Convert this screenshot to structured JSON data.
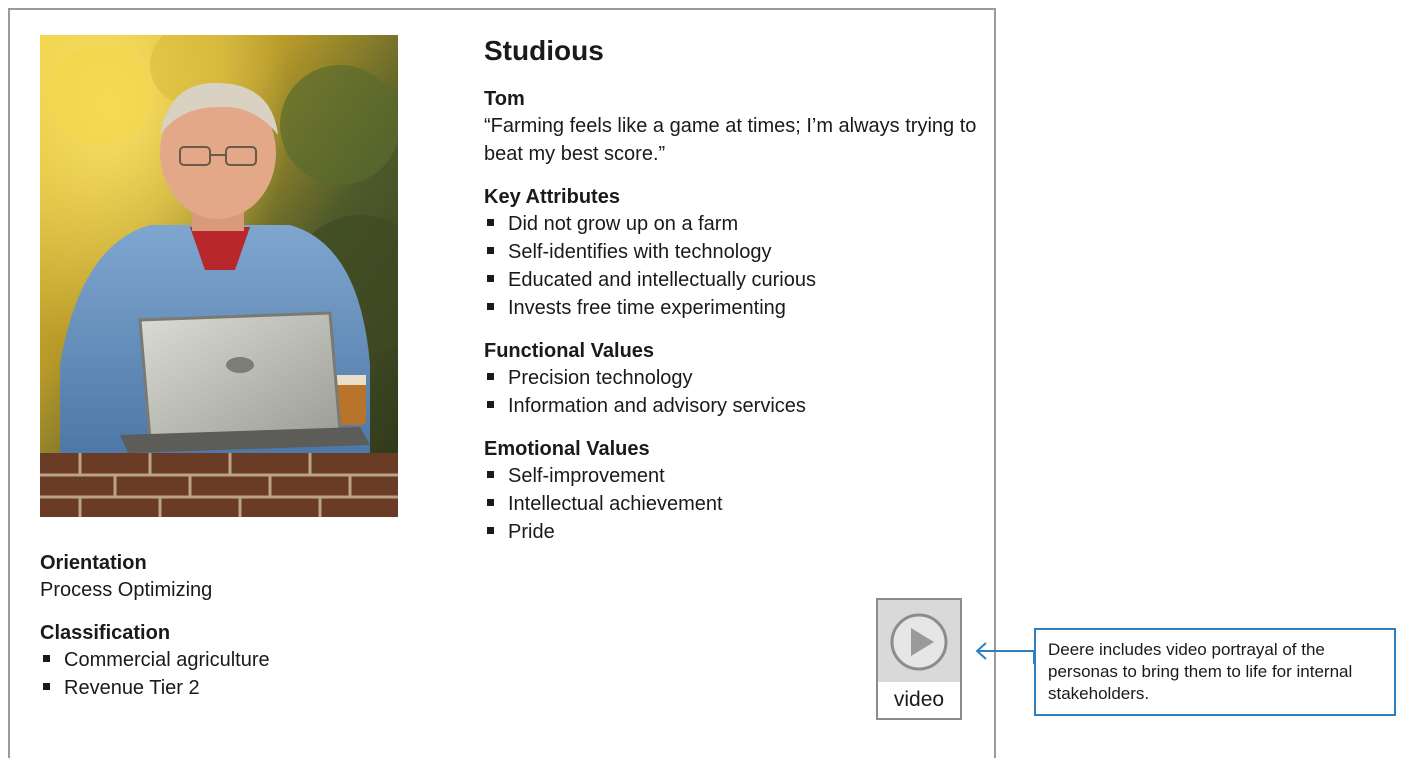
{
  "persona": {
    "title": "Studious",
    "name": "Tom",
    "quote": "“Farming feels like a game at times; I’m always trying to beat my best score.”",
    "photo_icon": "farmer-with-laptop-photo"
  },
  "key_attributes": {
    "heading": "Key Attributes",
    "items": [
      "Did not grow up on a farm",
      "Self-identifies with technology",
      "Educated and intellectually curious",
      "Invests free time experimenting"
    ]
  },
  "functional_values": {
    "heading": "Functional Values",
    "items": [
      "Precision technology",
      "Information and advisory services"
    ]
  },
  "emotional_values": {
    "heading": "Emotional Values",
    "items": [
      "Self-improvement",
      "Intellectual achievement",
      "Pride"
    ]
  },
  "orientation": {
    "heading": "Orientation",
    "value": "Process Optimizing"
  },
  "classification": {
    "heading": "Classification",
    "items": [
      "Commercial agriculture",
      "Revenue Tier 2"
    ]
  },
  "video": {
    "label": "video",
    "icon": "play-icon"
  },
  "callout": {
    "text": "Deere includes video portrayal of the personas to bring them to life for internal stakeholders.",
    "border_color": "#2f7fbf"
  }
}
